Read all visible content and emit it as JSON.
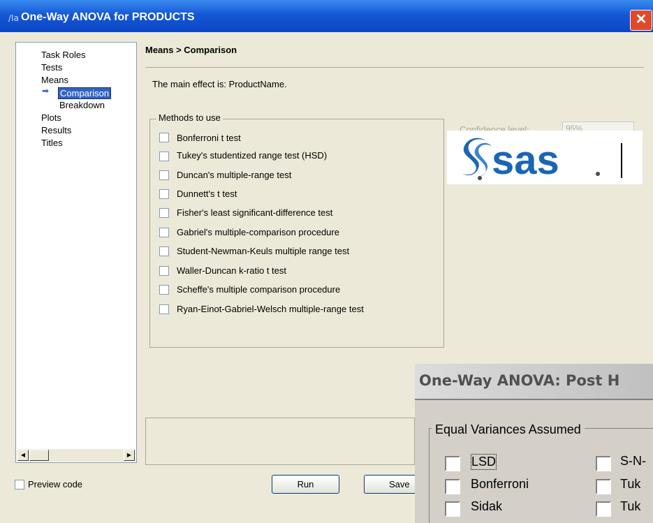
{
  "window": {
    "title": "One-Way ANOVA for PRODUCTS",
    "close_glyph": "✕"
  },
  "nav": {
    "items": [
      {
        "label": "Task Roles"
      },
      {
        "label": "Tests"
      },
      {
        "label": "Means"
      },
      {
        "label": "Comparison"
      },
      {
        "label": "Breakdown"
      },
      {
        "label": "Plots"
      },
      {
        "label": "Results"
      },
      {
        "label": "Titles"
      }
    ],
    "arrow_glyph": "➡"
  },
  "main": {
    "header": "Means > Comparison",
    "effect_text": "The main effect is: ProductName.",
    "methods_legend": "Methods to use",
    "methods": [
      {
        "label": "Bonferroni t test"
      },
      {
        "label": "Tukey's studentized range test (HSD)"
      },
      {
        "label": "Duncan's multiple-range test"
      },
      {
        "label": "Dunnett's t test"
      },
      {
        "label": "Fisher's least significant-difference test"
      },
      {
        "label": "Gabriel's multiple-comparison procedure"
      },
      {
        "label": "Student-Newman-Keuls multiple range test"
      },
      {
        "label": "Waller-Duncan k-ratio t test"
      },
      {
        "label": "Scheffe's multiple comparison procedure"
      },
      {
        "label": "Ryan-Einot-Gabriel-Welsch multiple-range test"
      }
    ],
    "confidence_label": "Confidence level:",
    "confidence_value": "95%"
  },
  "logo": {
    "text": "sas",
    "brand_color": "#1a66b4"
  },
  "footer": {
    "preview_label": "Preview code",
    "run_label": "Run",
    "save_label": "Save"
  },
  "overlay": {
    "title": "One-Way ANOVA: Post H",
    "group_legend": "Equal Variances Assumed",
    "items": [
      {
        "label": "LSD"
      },
      {
        "label": "S-N-"
      },
      {
        "label": "Bonferroni"
      },
      {
        "label": "Tuk"
      },
      {
        "label": "Sidak"
      },
      {
        "label": "Tuk"
      }
    ]
  }
}
